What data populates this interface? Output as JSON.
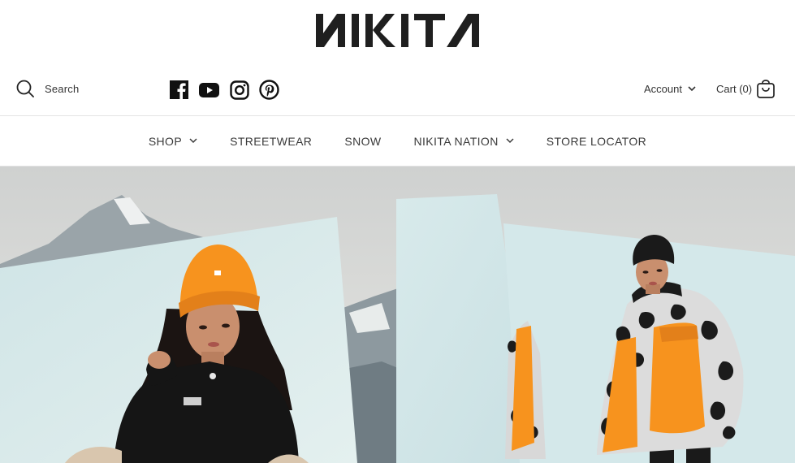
{
  "brand": {
    "name": "NIKITA"
  },
  "header": {
    "search_label": "Search",
    "social_icons": [
      "facebook-icon",
      "youtube-icon",
      "instagram-icon",
      "pinterest-icon"
    ],
    "account_label": "Account",
    "cart_label": "Cart",
    "cart_count": "(0)"
  },
  "nav": {
    "items": [
      {
        "label": "SHOP",
        "has_dropdown": true
      },
      {
        "label": "STREETWEAR",
        "has_dropdown": false
      },
      {
        "label": "SNOW",
        "has_dropdown": false
      },
      {
        "label": "NIKITA NATION",
        "has_dropdown": true
      },
      {
        "label": "STORE LOCATOR",
        "has_dropdown": false
      }
    ]
  },
  "hero": {
    "image": "snowwear-campaign-photo",
    "colors": {
      "sky": "#d9dcdc",
      "panel": "#d5e8ea",
      "orange": "#f7931e",
      "black": "#151515",
      "skin": "#c98f6e",
      "mountain": "#8e9aa2"
    }
  },
  "colors": {
    "text": "#333333",
    "divider": "#e3e3e3",
    "background": "#ffffff"
  }
}
